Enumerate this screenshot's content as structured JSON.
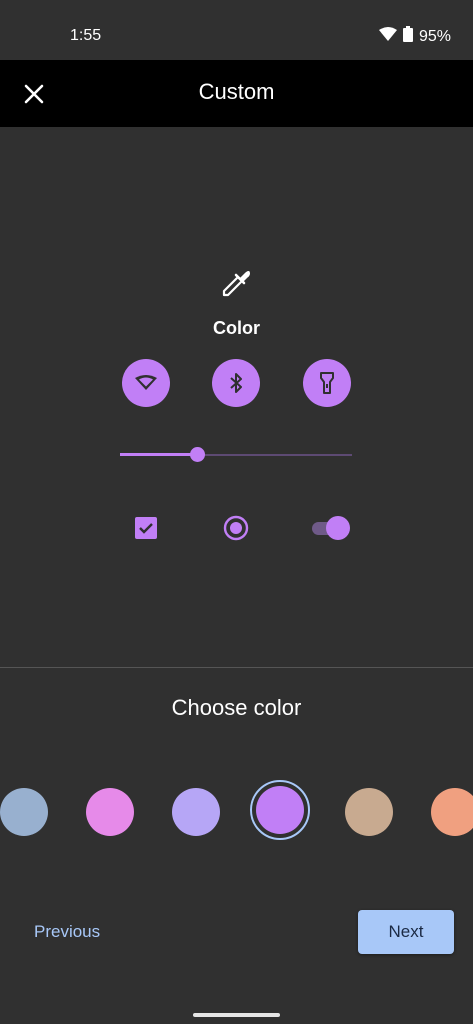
{
  "status": {
    "time": "1:55",
    "battery": "95%"
  },
  "appbar": {
    "title": "Custom",
    "close_icon": "close-icon"
  },
  "preview": {
    "icon": "eyedropper-icon",
    "label": "Color",
    "accent": "#c17ff6",
    "quick_settings": [
      "wifi-icon",
      "bluetooth-icon",
      "flashlight-icon"
    ],
    "slider_value": 0.33,
    "checkbox_checked": true,
    "radio_selected": true,
    "switch_on": true
  },
  "picker": {
    "title": "Choose color",
    "swatches": [
      "#98b0cf",
      "#e68ae9",
      "#b6a6f6",
      "#c17ff6",
      "#c8aa90",
      "#f0a080"
    ],
    "selected_index": 3
  },
  "nav": {
    "previous_label": "Previous",
    "next_label": "Next"
  },
  "colors": {
    "background": "#303030",
    "appbar": "#000000",
    "action": "#a8c8f8"
  }
}
